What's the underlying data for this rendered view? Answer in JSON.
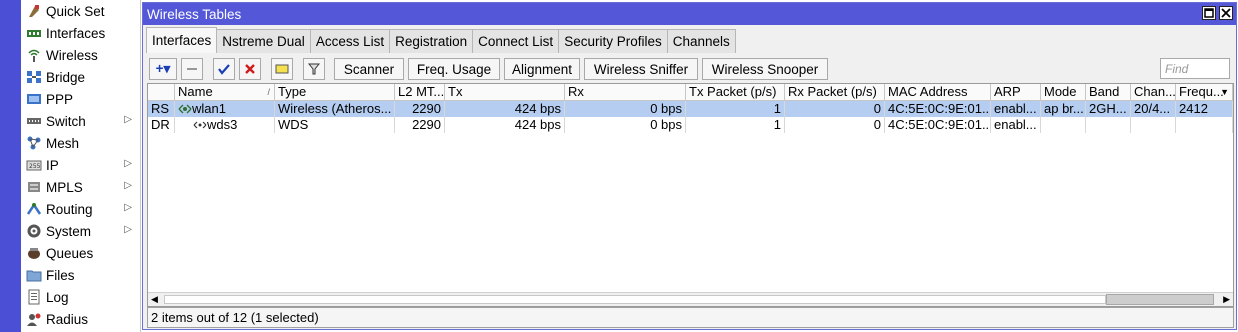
{
  "sidebar": {
    "items": [
      {
        "label": "Quick Set",
        "icon": "quick-set-icon",
        "has_sub": false
      },
      {
        "label": "Interfaces",
        "icon": "interfaces-icon",
        "has_sub": false
      },
      {
        "label": "Wireless",
        "icon": "wireless-icon",
        "has_sub": false
      },
      {
        "label": "Bridge",
        "icon": "bridge-icon",
        "has_sub": false
      },
      {
        "label": "PPP",
        "icon": "ppp-icon",
        "has_sub": false
      },
      {
        "label": "Switch",
        "icon": "switch-icon",
        "has_sub": true
      },
      {
        "label": "Mesh",
        "icon": "mesh-icon",
        "has_sub": false
      },
      {
        "label": "IP",
        "icon": "ip-icon",
        "has_sub": true
      },
      {
        "label": "MPLS",
        "icon": "mpls-icon",
        "has_sub": true
      },
      {
        "label": "Routing",
        "icon": "routing-icon",
        "has_sub": true
      },
      {
        "label": "System",
        "icon": "system-icon",
        "has_sub": true
      },
      {
        "label": "Queues",
        "icon": "queues-icon",
        "has_sub": false
      },
      {
        "label": "Files",
        "icon": "files-icon",
        "has_sub": false
      },
      {
        "label": "Log",
        "icon": "log-icon",
        "has_sub": false
      },
      {
        "label": "Radius",
        "icon": "radius-icon",
        "has_sub": false
      }
    ]
  },
  "window": {
    "title": "Wireless Tables",
    "tabs": [
      "Interfaces",
      "Nstreme Dual",
      "Access List",
      "Registration",
      "Connect List",
      "Security Profiles",
      "Channels"
    ],
    "active_tab": "Interfaces"
  },
  "toolbar": {
    "add": "+▾",
    "scanner": "Scanner",
    "freq_usage": "Freq. Usage",
    "alignment": "Alignment",
    "sniffer": "Wireless Sniffer",
    "snooper": "Wireless Snooper",
    "find_placeholder": "Find"
  },
  "table": {
    "columns": [
      "",
      "Name",
      "Type",
      "L2 MT...",
      "Tx",
      "Rx",
      "Tx Packet (p/s)",
      "Rx Packet (p/s)",
      "MAC Address",
      "ARP",
      "Mode",
      "Band",
      "Chan...",
      "Frequ..."
    ],
    "rows": [
      {
        "flags": "RS",
        "name": "wlan1",
        "type": "Wireless (Atheros...",
        "l2mtu": "2290",
        "tx": "424 bps",
        "rx": "0 bps",
        "txp": "1",
        "rxp": "0",
        "mac": "4C:5E:0C:9E:01...",
        "arp": "enabl...",
        "mode": "ap br...",
        "band": "2GH...",
        "chan": "20/4...",
        "freq": "2412",
        "selected": true
      },
      {
        "flags": "DR",
        "name": "wds3",
        "type": "WDS",
        "l2mtu": "2290",
        "tx": "424 bps",
        "rx": "0 bps",
        "txp": "1",
        "rxp": "0",
        "mac": "4C:5E:0C:9E:01...",
        "arp": "enabl...",
        "mode": "",
        "band": "",
        "chan": "",
        "freq": "",
        "selected": false
      }
    ]
  },
  "status": "2 items out of 12 (1 selected)",
  "colors": {
    "titlebar": "#5357d8",
    "strip": "#4b4fd6",
    "selection": "#b4cdf0"
  }
}
